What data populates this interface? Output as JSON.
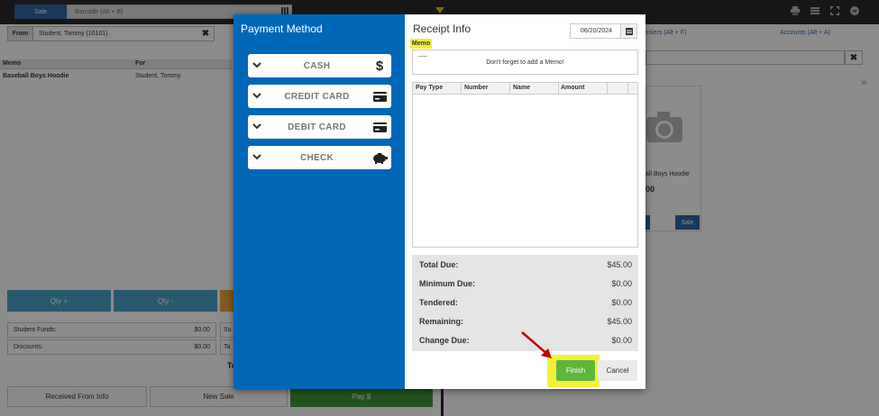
{
  "background": {
    "sale_tab": "Sale",
    "barcode_placeholder": "Barcode (Alt + B)",
    "from_label": "From",
    "from_value": "Student, Tommy (10101)",
    "cart_headers": {
      "memo": "Memo",
      "for": "For"
    },
    "cart_rows": [
      {
        "memo": "Baseball Boys Hoodie",
        "for": "Student, Tommy"
      }
    ],
    "qty_plus": "Qty +",
    "qty_minus": "Qty -",
    "student_funds_label": "Student Funds:",
    "student_funds_value": "$0.00",
    "discounts_label": "Discounts:",
    "discounts_value": "$0.00",
    "side_s1": "Su",
    "side_s2": "Ta",
    "total_partial": "To",
    "received_from_info": "Received From Info",
    "new_sale": "New Sale",
    "pay": "Pay $",
    "cashiers_tab": "ssiers (Alt + F)",
    "accounts_tab": "Accounts (Alt + A)",
    "product_name": "all Boys Hoodie",
    "product_price": "00",
    "product_sale_button": "Sale"
  },
  "modal": {
    "payment_method_title": "Payment Method",
    "payment_methods": [
      {
        "label": "CASH",
        "icon": "dollar-icon"
      },
      {
        "label": "CREDIT CARD",
        "icon": "card-icon"
      },
      {
        "label": "DEBIT CARD",
        "icon": "card-icon"
      },
      {
        "label": "CHECK",
        "icon": "piggy-bank-icon"
      }
    ],
    "receipt_info_title": "Receipt Info",
    "date": "06/20/2024",
    "memo_label": "Memo",
    "memo_text": "Don't forget to add a Memo!",
    "table_headers": [
      "Pay Type",
      "Number",
      "Name",
      "Amount"
    ],
    "totals": [
      {
        "label": "Total Due:",
        "value": "$45.00"
      },
      {
        "label": "Minimum Due:",
        "value": "$0.00"
      },
      {
        "label": "Tendered:",
        "value": "$0.00"
      },
      {
        "label": "Remaining:",
        "value": "$45.00"
      },
      {
        "label": "Change Due:",
        "value": "$0.00"
      }
    ],
    "finish_label": "Finish",
    "cancel_label": "Cancel"
  },
  "colors": {
    "payment_panel": "#0067b8",
    "highlight": "#f4f03a",
    "finish": "#5cb83a",
    "arrow": "#c00000"
  }
}
